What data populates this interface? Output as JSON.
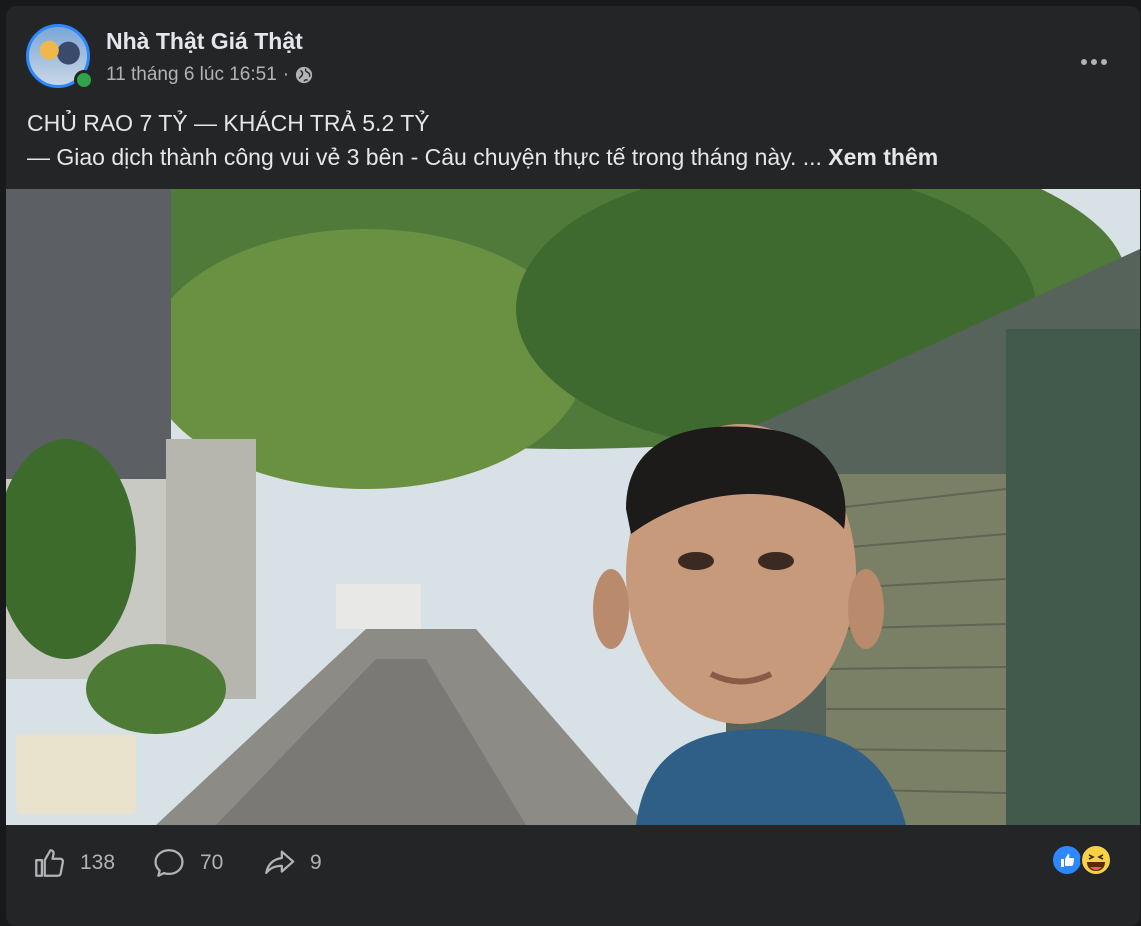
{
  "post": {
    "author": "Nhà Thật Giá Thật",
    "timestamp": "11 tháng 6 lúc 16:51",
    "separator": "·",
    "privacy_icon": "globe-icon",
    "title_line": "CHỦ RAO 7 TỶ — KHÁCH TRẢ 5.2 TỶ",
    "body_line": "— Giao dịch thành công vui vẻ 3 bên - Câu chuyện thực tế trong tháng này.  ...",
    "see_more": "Xem thêm",
    "photo_alt": "Selfie in a tree-lined alley"
  },
  "actions": {
    "likes": "138",
    "comments": "70",
    "shares": "9"
  },
  "reactions": [
    "like-icon",
    "haha-icon"
  ],
  "colors": {
    "background": "#18191a",
    "card": "#242526",
    "text": "#e4e6eb",
    "secondary": "#b0b3b8",
    "accent": "#2d88ff",
    "online": "#31a24c"
  }
}
